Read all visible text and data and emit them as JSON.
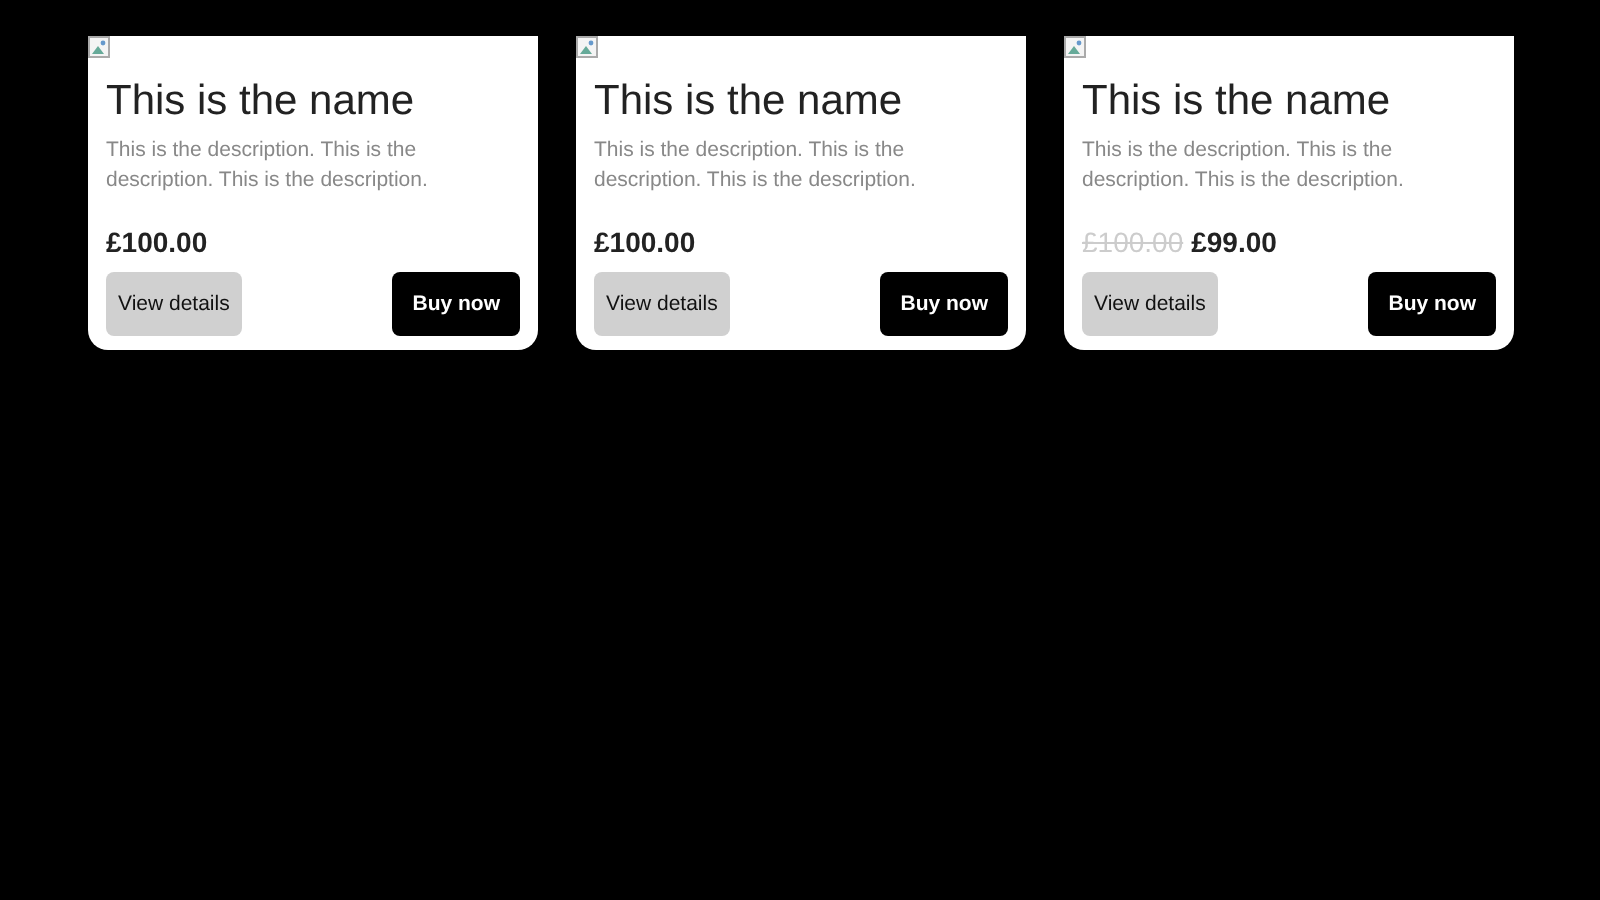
{
  "cards": [
    {
      "name": "This is the name",
      "description": "This is the description. This is the description. This is the description.",
      "price": "£100.00",
      "details_button": "View details",
      "buy_button": "Buy now"
    },
    {
      "name": "This is the name",
      "description": "This is the description. This is the description. This is the description.",
      "price": "£100.00",
      "details_button": "View details",
      "buy_button": "Buy now"
    },
    {
      "name": "This is the name",
      "description": "This is the description. This is the description. This is the description.",
      "original_price": "£100.00",
      "price": "£99.00",
      "details_button": "View details",
      "buy_button": "Buy now"
    }
  ]
}
